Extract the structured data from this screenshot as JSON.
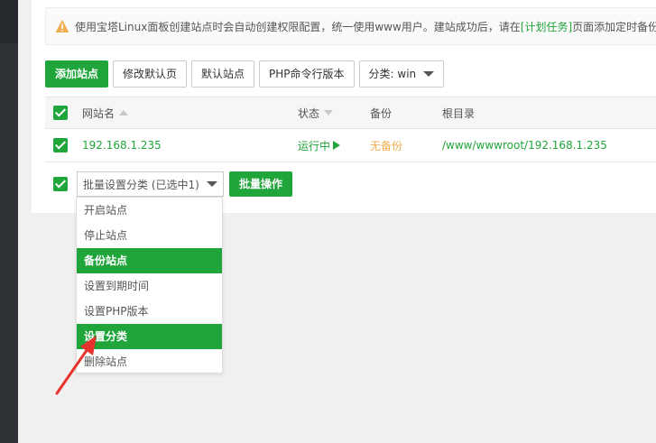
{
  "tip": {
    "text_before": "使用宝塔Linux面板创建站点时会自动创建权限配置，统一使用www用户。建站成功后，请在",
    "link": "[计划任务]",
    "text_after": "页面添加定时备份"
  },
  "toolbar": {
    "add_site": "添加站点",
    "modify_default_page": "修改默认页",
    "default_site": "默认站点",
    "php_cli_version": "PHP命令行版本",
    "category_select": "分类: win"
  },
  "table": {
    "headers": {
      "site_name": "网站名",
      "status": "状态",
      "backup": "备份",
      "root_dir": "根目录"
    },
    "rows": [
      {
        "site_name": "192.168.1.235",
        "status": "运行中",
        "backup": "无备份",
        "root_dir": "/www/wwwroot/192.168.1.235"
      }
    ]
  },
  "batch": {
    "select_value": "批量设置分类 (已选中1)",
    "action_button": "批量操作",
    "options": [
      {
        "label": "开启站点",
        "highlighted": false
      },
      {
        "label": "停止站点",
        "highlighted": false
      },
      {
        "label": "备份站点",
        "highlighted": true
      },
      {
        "label": "设置到期时间",
        "highlighted": false
      },
      {
        "label": "设置PHP版本",
        "highlighted": false
      },
      {
        "label": "设置分类",
        "highlighted": true
      },
      {
        "label": "删除站点",
        "highlighted": false
      }
    ]
  },
  "colors": {
    "accent_green": "#20a53a",
    "warning_orange": "#f0ad4e",
    "annotation_red": "#e8322d"
  }
}
